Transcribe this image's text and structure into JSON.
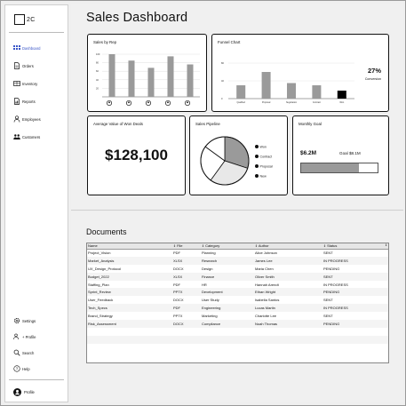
{
  "app": {
    "logo_text": "2C"
  },
  "sidebar": {
    "items": [
      {
        "label": "Dashboard",
        "icon": "dashboard-icon",
        "active": true
      },
      {
        "label": "Orders",
        "icon": "orders-icon"
      },
      {
        "label": "Inventory",
        "icon": "inventory-icon"
      },
      {
        "label": "Reports",
        "icon": "reports-icon"
      },
      {
        "label": "Employees",
        "icon": "employees-icon"
      },
      {
        "label": "Customers",
        "icon": "customers-icon"
      }
    ],
    "bottom_items": [
      {
        "label": "Settings",
        "icon": "gear-icon"
      },
      {
        "label": "+ Profile",
        "icon": "add-profile-icon"
      },
      {
        "label": "Search",
        "icon": "search-icon"
      },
      {
        "label": "Help",
        "icon": "help-icon"
      }
    ],
    "profile_label": "Profile"
  },
  "dashboard": {
    "title": "Sales Dashboard",
    "cards": {
      "sales_by_rep": {
        "title": "Sales by Rep"
      },
      "funnel": {
        "title": "Funnel Chart",
        "conversion_value": "27%",
        "conversion_label": "Conversion"
      },
      "avg_won": {
        "title": "Average Value of Won Deals",
        "value": "$128,100"
      },
      "pipeline": {
        "title": "Sales Pipeline"
      },
      "goal": {
        "title": "Monthly Goal",
        "current": "$6.2M",
        "goal_label": "Goal $8.1M",
        "progress": 0.76
      }
    }
  },
  "chart_data": [
    {
      "type": "bar",
      "title": "Sales by Rep",
      "ylim": [
        0,
        100
      ],
      "y_ticks": [
        20,
        40,
        60,
        80,
        100
      ],
      "values": [
        100,
        85,
        68,
        95,
        76
      ],
      "bar_color": "#9a9a9a"
    },
    {
      "type": "bar",
      "title": "Funnel Chart",
      "categories": [
        "Qualified",
        "Proposal",
        "Negotiation",
        "Contract",
        "Won"
      ],
      "ylim": [
        0,
        100
      ],
      "y_ticks": [
        0,
        40,
        80
      ],
      "values": [
        30,
        60,
        35,
        30,
        18
      ],
      "highlight_index": 4,
      "bar_color": "#9a9a9a",
      "highlight_color": "#000000"
    },
    {
      "type": "pie",
      "title": "Sales Pipeline",
      "series": [
        {
          "name": "Won",
          "value": 25,
          "color": "#ffffff"
        },
        {
          "name": "Contract",
          "value": 15,
          "color": "#ffffff"
        },
        {
          "name": "Proposal",
          "value": 30,
          "color": "#9a9a9a"
        },
        {
          "name": "New",
          "value": 30,
          "color": "#e8e8e8"
        }
      ]
    }
  ],
  "documents": {
    "title": "Documents",
    "columns": [
      "Name",
      "File",
      "Category",
      "Author",
      "Status"
    ],
    "rows": [
      [
        "Project_Vision",
        "PDF",
        "Planning",
        "Alice Johnson",
        "SENT"
      ],
      [
        "Market_Analysis",
        "XLSX",
        "Research",
        "James Lee",
        "IN PROGRESS"
      ],
      [
        "UX_Design_Protocol",
        "DOCX",
        "Design",
        "Maria Chen",
        "PENDING"
      ],
      [
        "Budget_2022",
        "XLSX",
        "Finance",
        "Oliver Smith",
        "SENT"
      ],
      [
        "Staffing_Plan",
        "PDF",
        "HR",
        "Hannah Arendt",
        "IN PROGRESS"
      ],
      [
        "Sprint_Review",
        "PPTX",
        "Development",
        "Ethan Wright",
        "PENDING"
      ],
      [
        "User_Feedback",
        "DOCX",
        "User Study",
        "Isabella Santos",
        "SENT"
      ],
      [
        "Tech_Specs",
        "PDF",
        "Engineering",
        "Lucas Martin",
        "IN PROGRESS"
      ],
      [
        "Brand_Strategy",
        "PPTX",
        "Marketing",
        "Charlotte Lee",
        "SENT"
      ],
      [
        "Risk_Assessment",
        "DOCX",
        "Compliance",
        "Noah Thomas",
        "PENDING"
      ]
    ]
  }
}
